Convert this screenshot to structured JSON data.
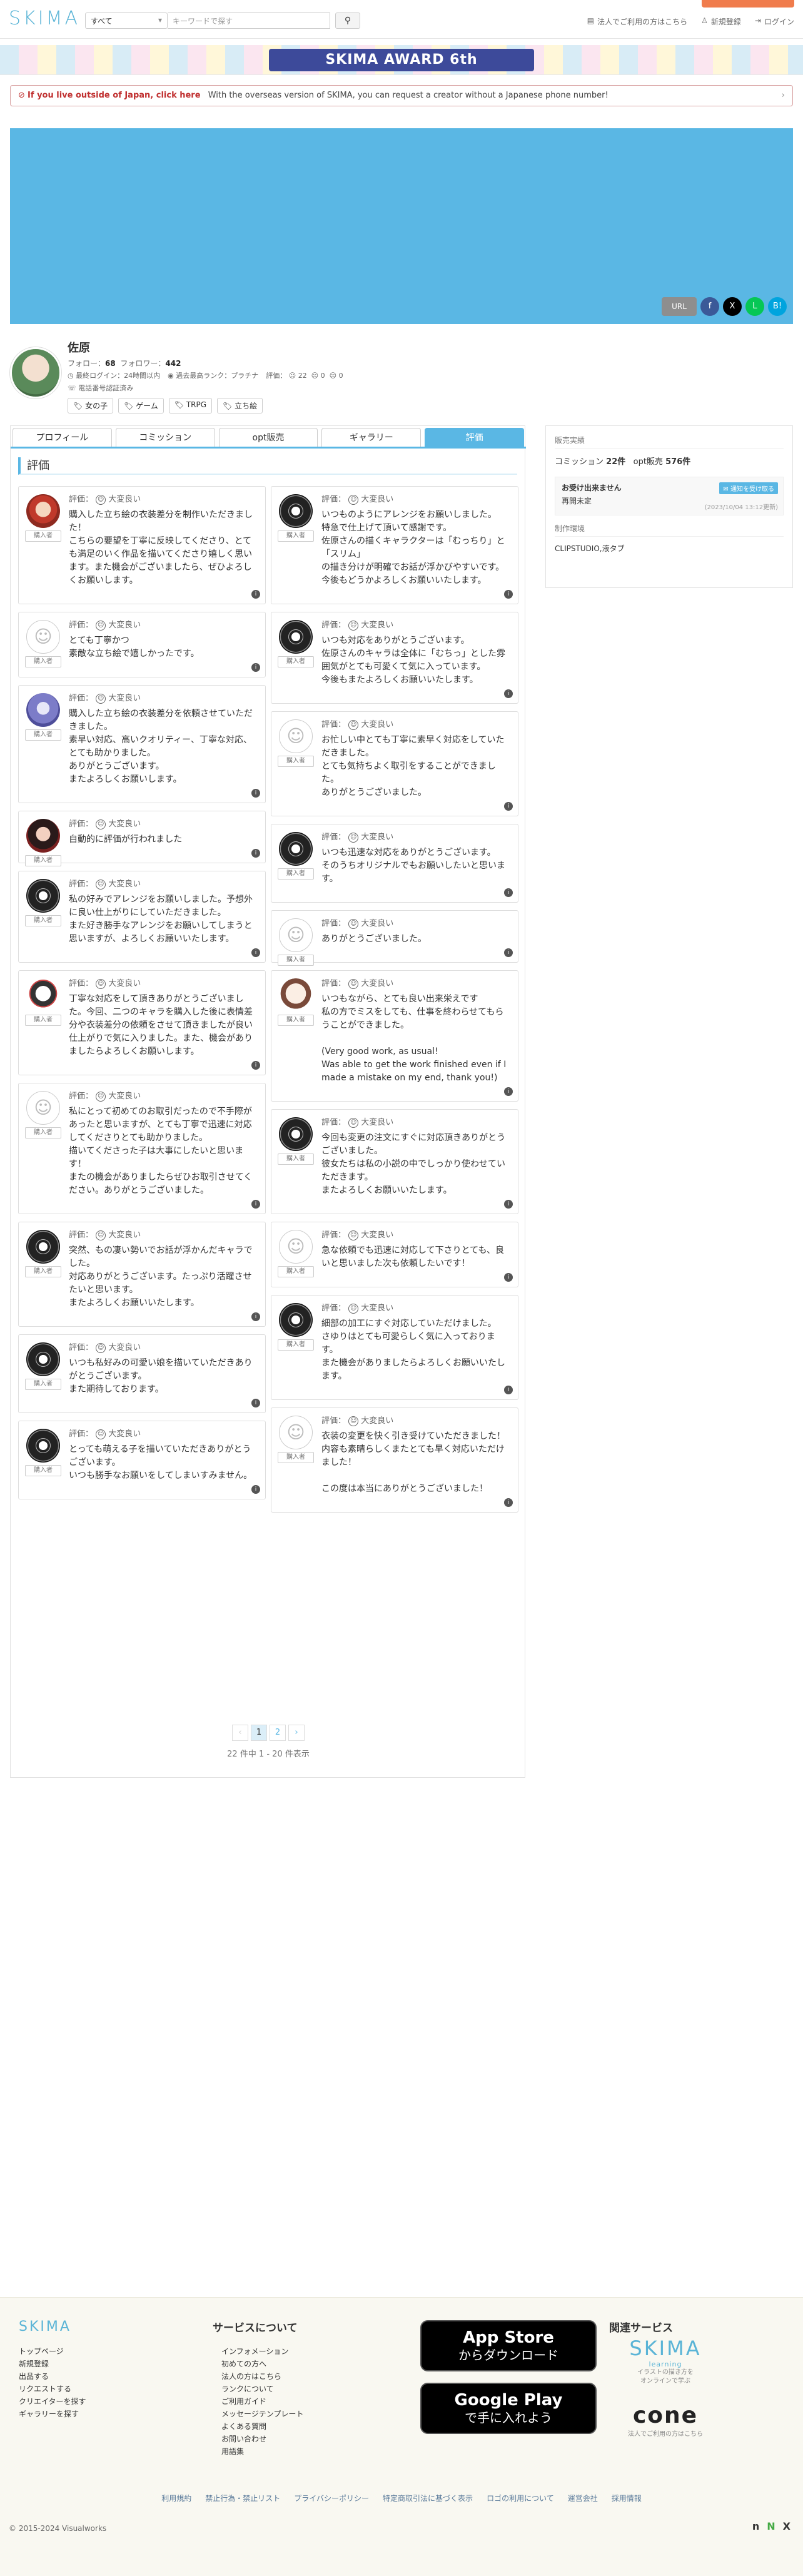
{
  "header": {
    "logo": "SKIMA",
    "category": "すべて",
    "search_placeholder": "キーワードで探す",
    "search_icon": "search-icon",
    "nav": [
      "法人でご利用の方はこちら",
      "新規登録",
      "ログイン"
    ]
  },
  "award_banner": "SKIMA AWARD 6th",
  "notice": {
    "bold": "If you live outside of Japan, click here",
    "text": "With the overseas version of SKIMA, you can request a creator without a Japanese phone number!"
  },
  "share": {
    "url_label": "URL",
    "icons": [
      "facebook-icon",
      "x-icon",
      "line-icon",
      "hatena-icon"
    ]
  },
  "profile": {
    "name": "佐原",
    "follow_label": "フォロー：",
    "follow": "68",
    "follower_label": "フォロワー：",
    "follower": "442",
    "meta": [
      "最終ログイン：24時間以内",
      "過去最高ランク：プラチナ",
      "評価：",
      "22",
      "0",
      "0"
    ],
    "phone": "電話番号認証済み",
    "tags": [
      "女の子",
      "ゲーム",
      "TRPG",
      "立ち絵"
    ]
  },
  "tabs": [
    "プロフィール",
    "コミッション",
    "opt販売",
    "ギャラリー",
    "評価"
  ],
  "section_title": "評価",
  "rating_label": "評価：",
  "rating_value": "大変良い",
  "buyer_label": "購入者",
  "reviews_left": [
    {
      "avatar": "a1",
      "text": "購入した立ち絵の衣装差分を制作いただきました！\nこちらの要望を丁寧に反映してくださり、とても満足のいく作品を描いてくださり嬉しく思います。また機会がございましたら、ぜひよろしくお願いします。"
    },
    {
      "avatar": "plain",
      "text": "とても丁寧かつ\n素敵な立ち絵で嬉しかったです。"
    },
    {
      "avatar": "a2",
      "text": "購入した立ち絵の衣装差分を依頼させていただきました。\n素早い対応、高いクオリティー、丁寧な対応、とても助かりました。\nありがとうございます。\nまたよろしくお願いします。"
    },
    {
      "avatar": "a3",
      "text": "自動的に評価が行われました"
    },
    {
      "avatar": "wheel",
      "text": "私の好みでアレンジをお願いしました。予想外に良い仕上がりにしていただきました。\nまた好き勝手なアレンジをお願いしてしまうと思いますが、よろしくお願いいたします。"
    },
    {
      "avatar": "a4",
      "text": "丁寧な対応をして頂きありがとうございました。今回、二つのキャラを購入した後に表情差分や衣装差分の依頼をさせて頂きましたが良い仕上がりで気に入りました。また、機会がありましたらよろしくお願いします。"
    },
    {
      "avatar": "plain",
      "text": "私にとって初めてのお取引だったので不手際があったと思いますが、とても丁寧で迅速に対応してくださりとても助かりました。\n描いてくださった子は大事にしたいと思います！\nまたの機会がありましたらぜひお取引させてください。ありがとうございました。"
    },
    {
      "avatar": "wheel",
      "text": "突然、もの凄い勢いでお話が浮かんだキャラでした。\n対応ありがとうございます。たっぷり活躍させたいと思います。\nまたよろしくお願いいたします。"
    },
    {
      "avatar": "wheel",
      "text": "いつも私好みの可愛い娘を描いていただきありがとうございます。\nまた期待しております。"
    },
    {
      "avatar": "wheel",
      "text": "とっても萌える子を描いていただきありがとうございます。\nいつも勝手なお願いをしてしまいすみません。"
    }
  ],
  "reviews_right": [
    {
      "avatar": "wheel",
      "text": "いつものようにアレンジをお願いしました。\n特急で仕上げて頂いて感謝です。\n佐原さんの描くキャラクターは「むっちり」と「スリム」\nの描き分けが明確でお話が浮かびやすいです。\n今後もどうかよろしくお願いいたします。"
    },
    {
      "avatar": "wheel",
      "text": "いつも対応をありがとうございます。\n佐原さんのキャラは全体に「むちっ」とした雰囲気がとても可愛くて気に入っています。\n今後もまたよろしくお願いいたします。"
    },
    {
      "avatar": "plain",
      "text": "お忙しい中とても丁寧に素早く対応をしていただきました。\nとても気持ちよく取引をすることができました。\nありがとうございました。"
    },
    {
      "avatar": "wheel",
      "text": "いつも迅速な対応をありがとうございます。\nそのうちオリジナルでもお願いしたいと思います。"
    },
    {
      "avatar": "plain",
      "text": "ありがとうございました。"
    },
    {
      "avatar": "a5",
      "text": "いつもながら、とても良い出来栄えです\n私の方でミスをしても、仕事を終わらせてもらうことができました。\n\n(Very good work, as usual!\nWas able to get the work finished even if I made a mistake on my end, thank you!)"
    },
    {
      "avatar": "wheel",
      "text": "今回も変更の注文にすぐに対応頂きありがとうございました。\n彼女たちは私の小説の中でしっかり使わせていただきます。\nまたよろしくお願いいたします。"
    },
    {
      "avatar": "plain",
      "text": "急な依頼でも迅速に対応して下さりとても、良いと思いました次も依頼したいです！"
    },
    {
      "avatar": "wheel",
      "text": "細部の加工にすぐ対応していただけました。\nさゆりはとても可愛らしく気に入っております。\nまた機会がありましたらよろしくお願いいたします。"
    },
    {
      "avatar": "plain",
      "text": "衣装の変更を快く引き受けていただきました！\n内容も素晴らしくまたとても早く対応いただけました！\n\nこの度は本当にありがとうございました！"
    }
  ],
  "pager": {
    "prev": "‹",
    "pages": [
      "1",
      "2"
    ],
    "next": "›",
    "count": "22 件中 1 - 20 件表示"
  },
  "side": {
    "title": "販売実績",
    "commission_label": "コミッション",
    "commission": "22件",
    "opt_label": "opt販売",
    "opt": "576件",
    "accept_title": "お受け出来ません",
    "accept_sub": "再開未定",
    "mail_btn": "通知を受け取る",
    "accept_date": "(2023/10/04 13:12更新)",
    "env_title": "制作環境",
    "env": "CLIPSTUDIO,液タブ"
  },
  "footer": {
    "logo": "SKIMA",
    "links": [
      "トップページ",
      "新規登録",
      "出品する",
      "リクエストする",
      "クリエイターを探す",
      "ギャラリーを探す"
    ],
    "service_title": "サービスについて",
    "services": [
      "インフォメーション",
      "初めての方へ",
      "法人の方はこちら",
      "ランクについて",
      "ご利用ガイド",
      "メッセージテンプレート",
      "よくある質問",
      "お問い合わせ",
      "用語集"
    ],
    "appstore": [
      "App Store",
      "からダウンロード"
    ],
    "googleplay": [
      "Google Play",
      "で手に入れよう"
    ],
    "related_title": "関連サービス",
    "rel1": "SKIMA",
    "rel1_sub": "learning",
    "rel1_desc": "イラストの描き方を\nオンラインで学ぶ",
    "rel2": "cone",
    "rel2_desc": "法人でご利用の方はこちら",
    "bottom": [
      "利用規約",
      "禁止行為・禁止リスト",
      "プライバシーポリシー",
      "特定商取引法に基づく表示",
      "ロゴの利用について",
      "運営会社",
      "採用情報"
    ],
    "copyright": "© 2015-2024 Visualworks"
  }
}
